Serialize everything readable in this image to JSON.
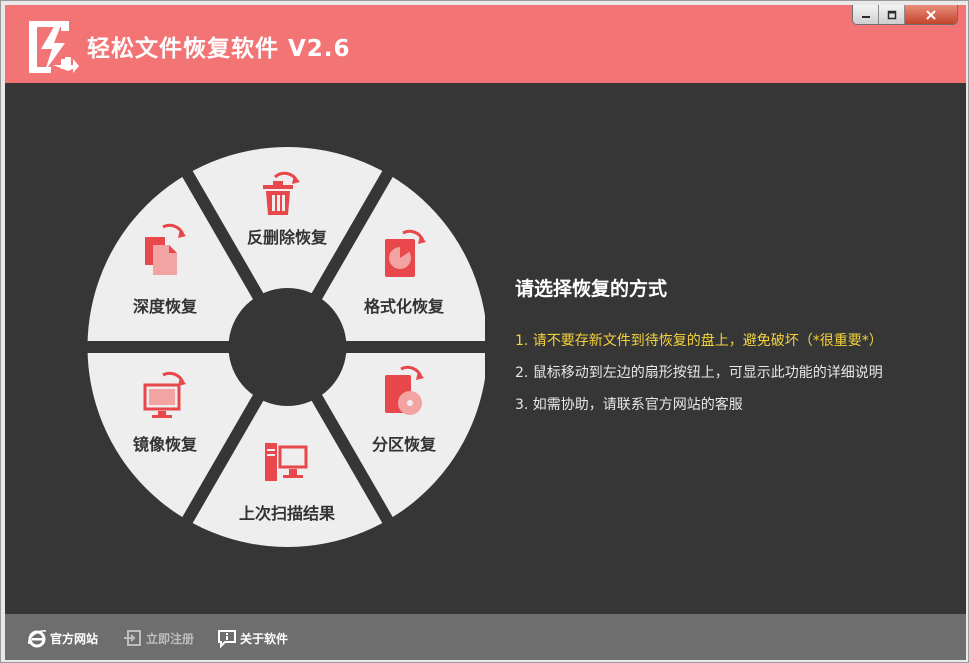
{
  "window": {
    "title": "轻松文件恢复软件 V2.6",
    "controls": {
      "minimize": "minimize-icon",
      "maximize": "maximize-icon",
      "close": "close-icon"
    }
  },
  "colors": {
    "titlebar": "#f37475",
    "content_bg": "#363636",
    "segment_bg": "#eeeeee",
    "icon_red": "#e8474b",
    "icon_pink": "#f4a3a3",
    "highlight_text": "#f3d23c",
    "footer_bg": "#6e6e6e"
  },
  "wheel": {
    "segments": [
      {
        "label": "反删除恢复",
        "icon": "trash-recover-icon"
      },
      {
        "label": "格式化恢复",
        "icon": "disk-format-icon"
      },
      {
        "label": "分区恢复",
        "icon": "partition-icon"
      },
      {
        "label": "上次扫描结果",
        "icon": "computer-icon"
      },
      {
        "label": "镜像恢复",
        "icon": "monitor-icon"
      },
      {
        "label": "深度恢复",
        "icon": "document-copy-icon"
      }
    ]
  },
  "info": {
    "title": "请选择恢复的方式",
    "lines": [
      "1. 请不要存新文件到待恢复的盘上，避免破坏（*很重要*）",
      "2. 鼠标移动到左边的扇形按钮上，可显示此功能的详细说明",
      "3. 如需协助，请联系官方网站的客服"
    ]
  },
  "footer": {
    "links": [
      {
        "label": "官方网站",
        "icon": "ie-icon",
        "enabled": true
      },
      {
        "label": "立即注册",
        "icon": "register-icon",
        "enabled": false
      },
      {
        "label": "关于软件",
        "icon": "info-icon",
        "enabled": true
      }
    ]
  }
}
